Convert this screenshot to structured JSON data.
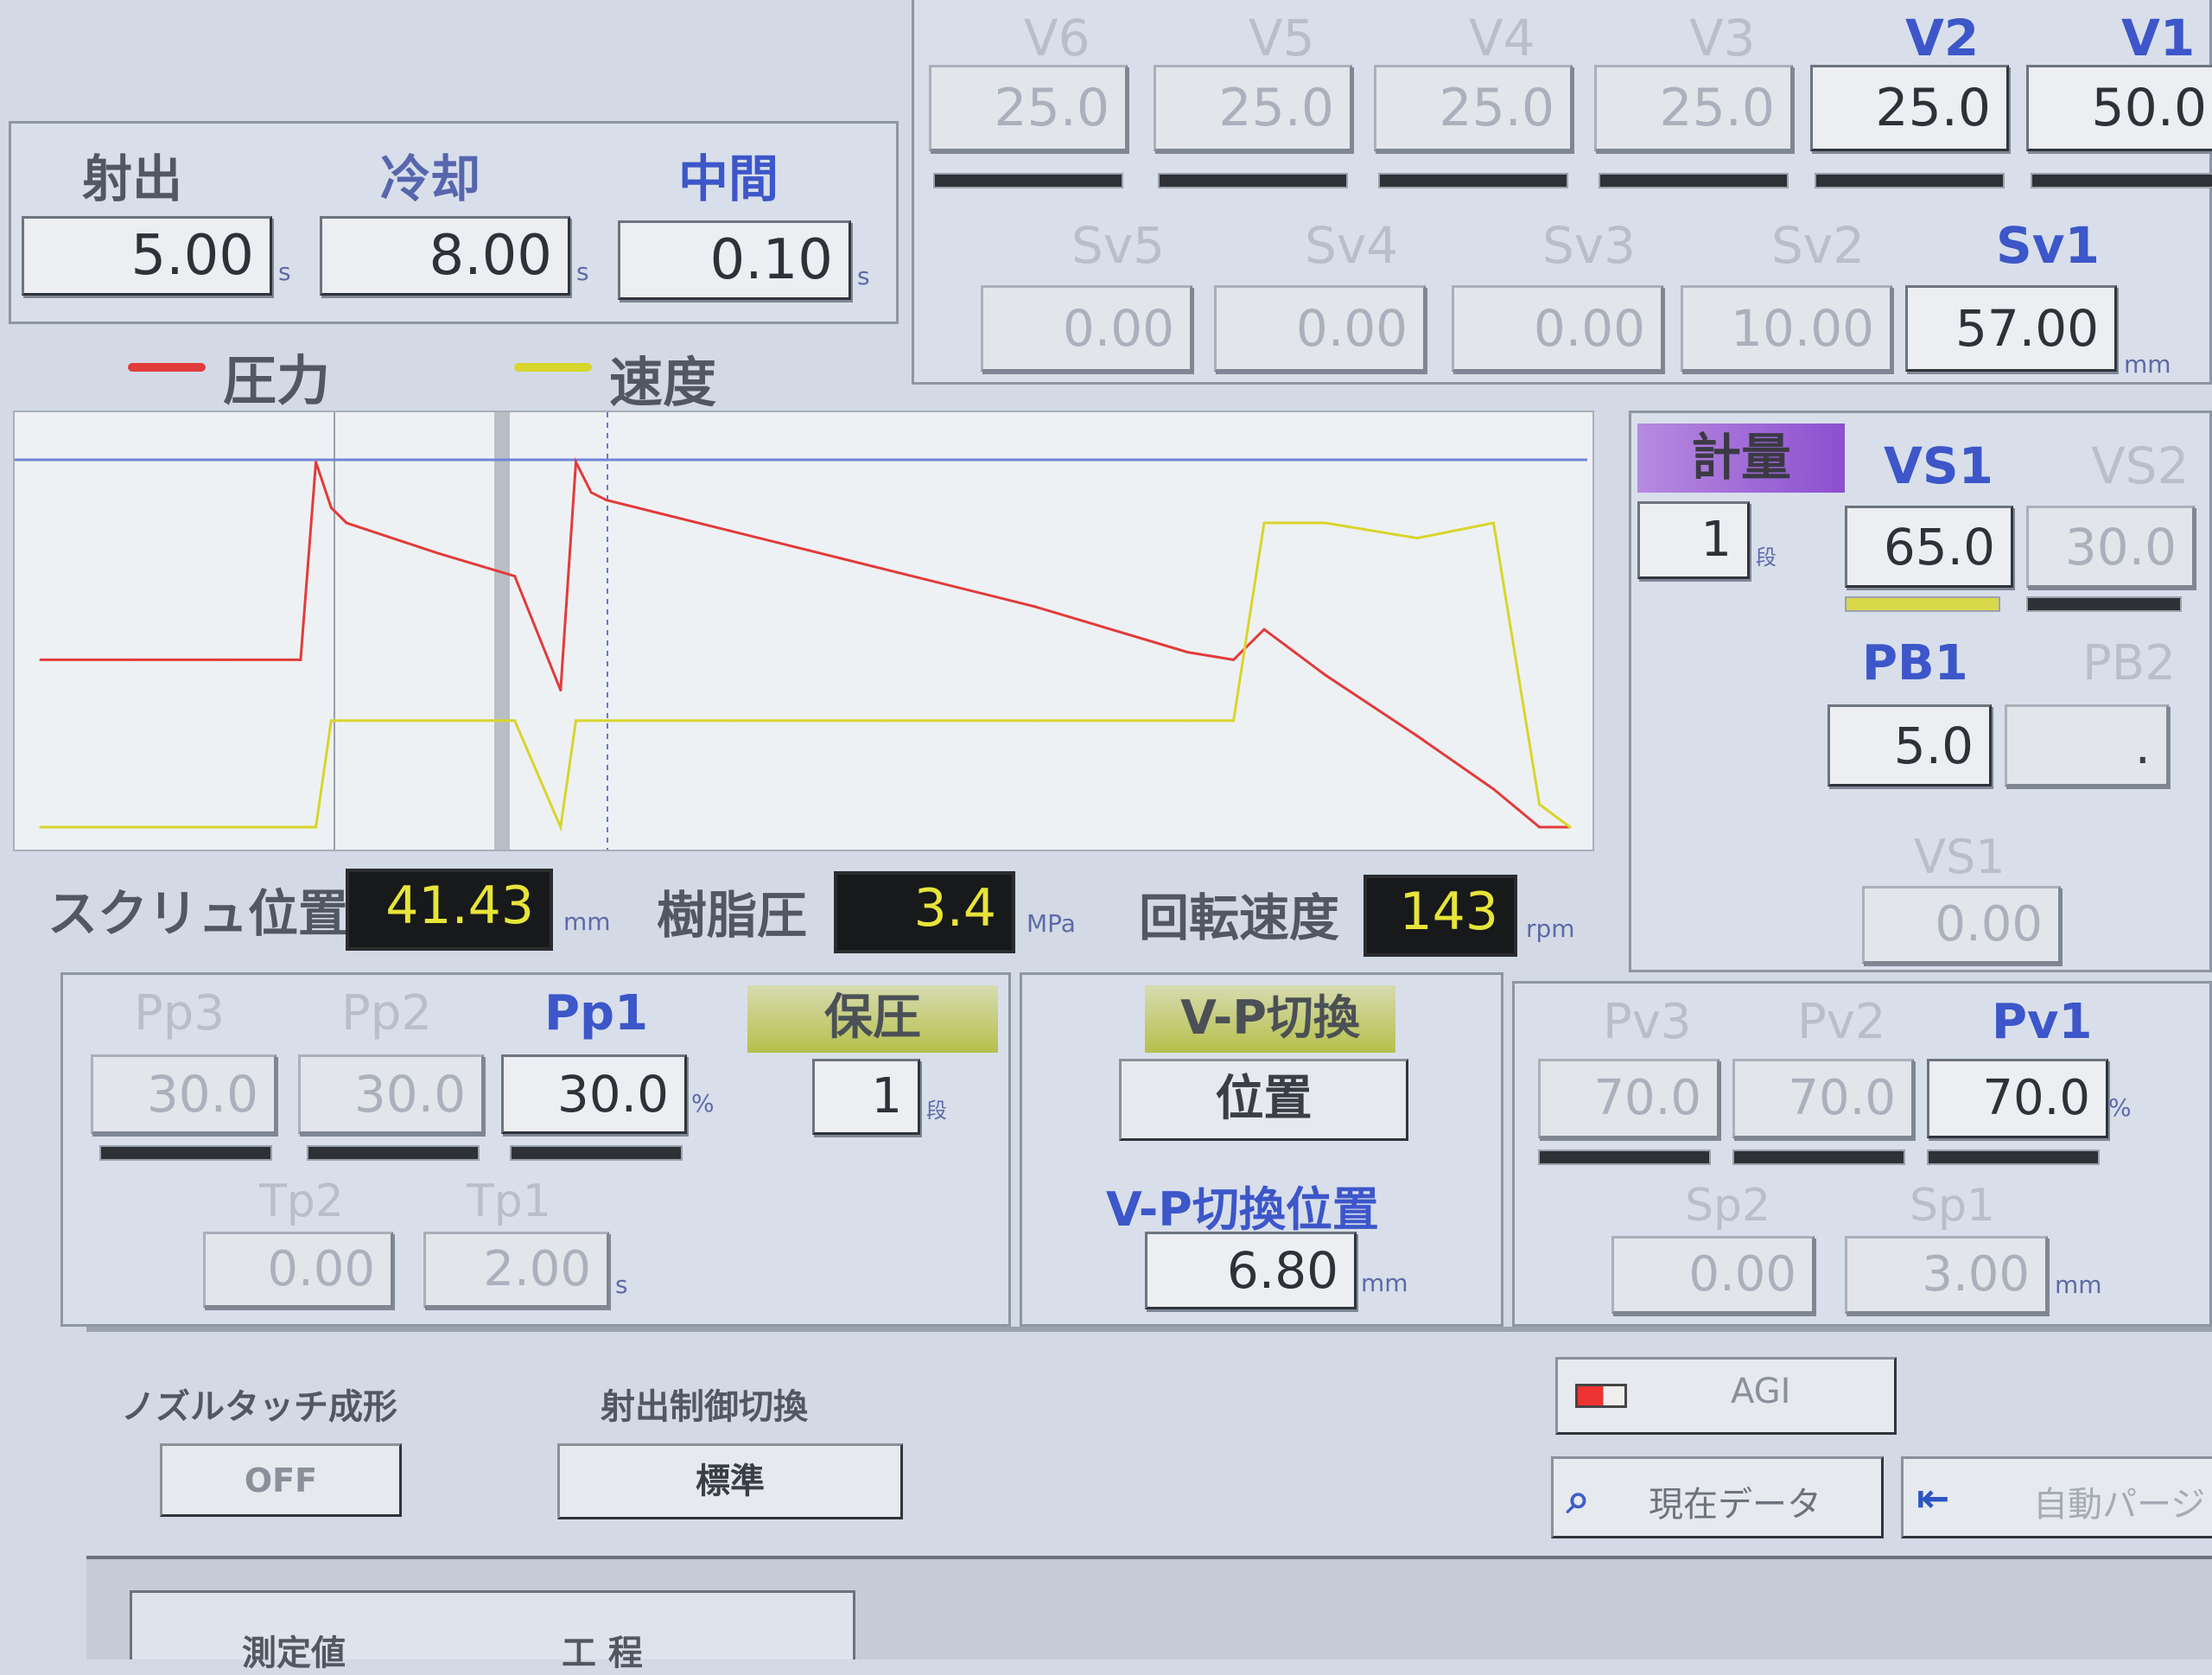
{
  "timers": {
    "injection_label": "射出",
    "injection_value": "5.00",
    "cooling_label": "冷却",
    "cooling_value": "8.00",
    "interval_label": "中間",
    "interval_value": "0.10",
    "unit": "s"
  },
  "injection_speed": {
    "labels": [
      "V6",
      "V5",
      "V4",
      "V3",
      "V2",
      "V1"
    ],
    "values": [
      "25.0",
      "25.0",
      "25.0",
      "25.0",
      "25.0",
      "50.0"
    ],
    "active": [
      false,
      false,
      false,
      false,
      true,
      true
    ]
  },
  "injection_position": {
    "labels": [
      "Sv5",
      "Sv4",
      "Sv3",
      "Sv2",
      "Sv1"
    ],
    "values": [
      "0.00",
      "0.00",
      "0.00",
      "10.00",
      "57.00"
    ],
    "active": [
      false,
      false,
      false,
      false,
      true
    ],
    "unit": "mm"
  },
  "legend": {
    "pressure_label": "圧力",
    "pressure_color": "#e23b3b",
    "speed_label": "速度",
    "speed_color": "#d8d52c"
  },
  "chart_data": {
    "type": "line",
    "title": "",
    "xlabel": "",
    "ylabel": "",
    "grid": false,
    "x": [
      0,
      6,
      12,
      17,
      18,
      19,
      20,
      26,
      31,
      34,
      35,
      36,
      37,
      45,
      55,
      65,
      75,
      78,
      80,
      84,
      90,
      95,
      98,
      100
    ],
    "series": [
      {
        "name": "圧力",
        "color": "#e23b3b",
        "values": [
          22,
          22,
          22,
          22,
          48,
          42,
          40,
          36,
          33,
          18,
          48,
          44,
          43,
          39,
          34,
          29,
          23,
          22,
          26,
          20,
          12,
          5,
          0,
          0
        ]
      },
      {
        "name": "速度",
        "color": "#d8d52c",
        "values": [
          0,
          0,
          0,
          0,
          0,
          14,
          14,
          14,
          14,
          0,
          14,
          14,
          14,
          14,
          14,
          14,
          14,
          14,
          40,
          40,
          38,
          40,
          3,
          0
        ]
      }
    ]
  },
  "monitors": {
    "screw_position_label": "スクリュ位置",
    "screw_position_value": "41.43",
    "screw_position_unit": "mm",
    "resin_pressure_label": "樹脂圧",
    "resin_pressure_value": "3.4",
    "resin_pressure_unit": "MPa",
    "rotation_speed_label": "回転速度",
    "rotation_speed_value": "143",
    "rotation_speed_unit": "rpm"
  },
  "metering": {
    "title": "計量",
    "stages_value": "1",
    "stages_unit": "段",
    "vs1_label": "VS1",
    "vs1_value": "65.0",
    "vs2_label": "VS2",
    "vs2_value": "30.0",
    "pb1_label": "PB1",
    "pb1_value": "5.0",
    "pb2_label": "PB2",
    "pb2_value": ".",
    "vs1_lower_label": "VS1",
    "vs1_lower_value": "0.00"
  },
  "holding": {
    "labels": [
      "Pp3",
      "Pp2",
      "Pp1"
    ],
    "values": [
      "30.0",
      "30.0",
      "30.0"
    ],
    "active": [
      false,
      false,
      true
    ],
    "unit": "%",
    "tab_label": "保圧",
    "stages_value": "1",
    "stages_unit": "段",
    "time_labels": [
      "Tp2",
      "Tp1"
    ],
    "time_values": [
      "0.00",
      "2.00"
    ],
    "time_unit": "s"
  },
  "vp": {
    "tab_label": "V-P切換",
    "mode_button": "位置",
    "position_label": "V-P切換位置",
    "position_value": "6.80",
    "position_unit": "mm"
  },
  "decompress": {
    "labels": [
      "Pv3",
      "Pv2",
      "Pv1"
    ],
    "values": [
      "70.0",
      "70.0",
      "70.0"
    ],
    "active": [
      false,
      false,
      true
    ],
    "unit": "%",
    "pos_labels": [
      "Sp2",
      "Sp1"
    ],
    "pos_values": [
      "0.00",
      "3.00"
    ],
    "pos_unit": "mm"
  },
  "bottom": {
    "nozzle_touch_label": "ノズルタッチ成形",
    "nozzle_touch_value": "OFF",
    "injection_control_label": "射出制御切換",
    "injection_control_value": "標準",
    "agi_button": "AGI",
    "current_data_button": "現在データ",
    "auto_purge_button": "自動パージ",
    "footer_left": "測定値",
    "footer_right": "工 程"
  }
}
